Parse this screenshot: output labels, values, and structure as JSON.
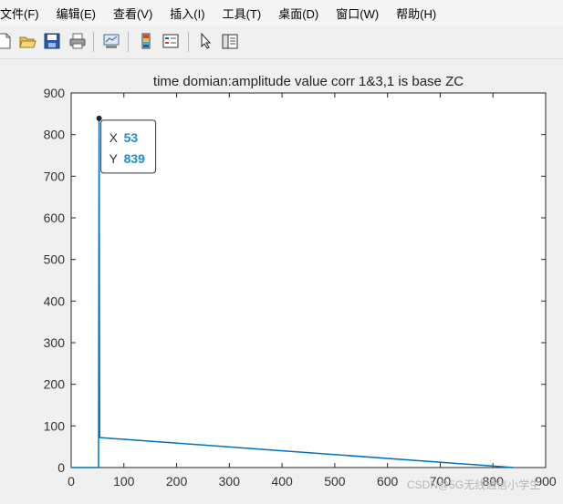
{
  "menu": {
    "items": [
      {
        "id": "file",
        "label": "文件(F)"
      },
      {
        "id": "edit",
        "label": "编辑(E)"
      },
      {
        "id": "view",
        "label": "查看(V)"
      },
      {
        "id": "insert",
        "label": "插入(I)"
      },
      {
        "id": "tools",
        "label": "工具(T)"
      },
      {
        "id": "desktop",
        "label": "桌面(D)"
      },
      {
        "id": "window",
        "label": "窗口(W)"
      },
      {
        "id": "help",
        "label": "帮助(H)"
      }
    ]
  },
  "toolbar": {
    "buttons": [
      {
        "id": "new",
        "icon": "new-file-icon"
      },
      {
        "id": "open",
        "icon": "open-folder-icon"
      },
      {
        "id": "save",
        "icon": "save-icon"
      },
      {
        "id": "print",
        "icon": "print-icon"
      },
      {
        "id": "link",
        "icon": "link-plot-icon"
      },
      {
        "id": "colorbar",
        "icon": "colorbar-icon"
      },
      {
        "id": "legend",
        "icon": "legend-icon"
      },
      {
        "id": "pointer",
        "icon": "pointer-icon"
      },
      {
        "id": "property",
        "icon": "property-editor-icon"
      }
    ]
  },
  "chart_data": {
    "type": "line",
    "title": "time domian:amplitude value corr 1&3,1 is base ZC",
    "xlabel": "",
    "ylabel": "",
    "xlim": [
      0,
      900
    ],
    "ylim": [
      0,
      900
    ],
    "xticks": [
      0,
      100,
      200,
      300,
      400,
      500,
      600,
      700,
      800,
      900
    ],
    "yticks": [
      0,
      100,
      200,
      300,
      400,
      500,
      600,
      700,
      800,
      900
    ],
    "grid": false,
    "color": "#0072bd",
    "x": [
      0,
      52,
      53,
      54,
      839
    ],
    "y": [
      0,
      0,
      839,
      72,
      0
    ],
    "datatip": {
      "x_label": "X",
      "x_value": "53",
      "y_label": "Y",
      "y_value": "839",
      "value_color": "#1a8fd4"
    }
  },
  "watermark": "CSDN@5G无线通信小学生"
}
